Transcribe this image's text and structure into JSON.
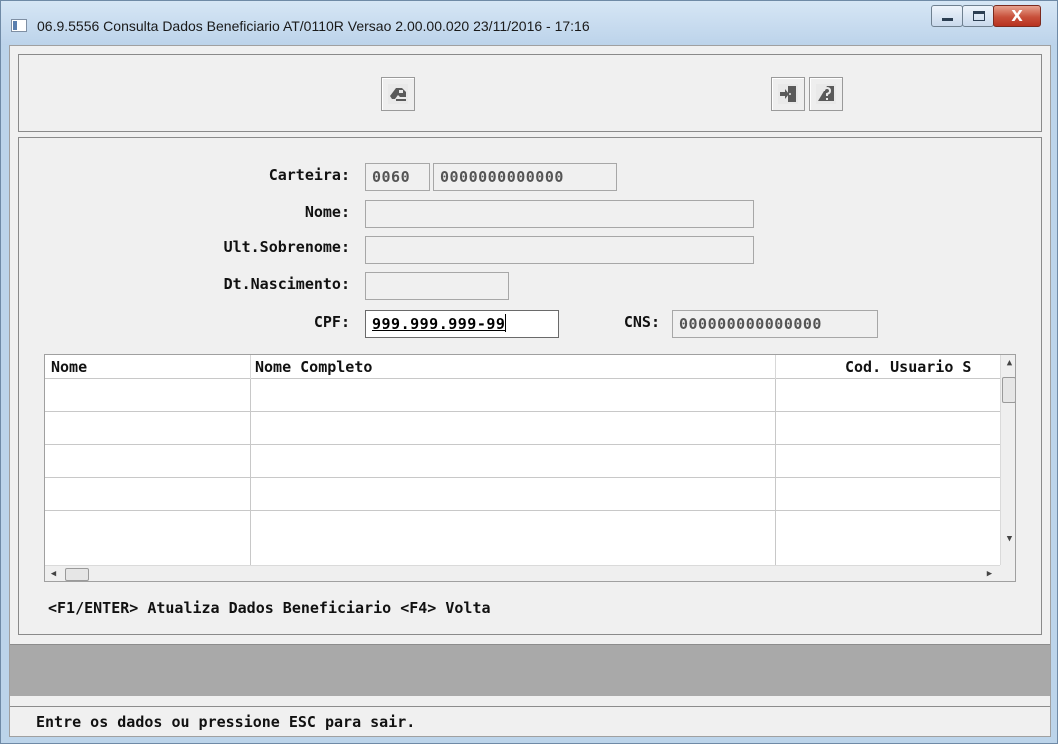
{
  "window": {
    "title": "06.9.5556  Consulta Dados Beneficiario AT/0110R Versao 2.00.00.020 23/11/2016 - 17:16",
    "close_glyph": "X"
  },
  "toolbar": {
    "left_icon": "key-icon",
    "exit_icon": "exit-door-icon",
    "help_icon": "help-icon"
  },
  "form": {
    "carteira_label": "Carteira:",
    "carteira_prefix": "0060",
    "carteira_number": "0000000000000",
    "nome_label": "Nome:",
    "nome_value": "",
    "ult_sobrenome_label": "Ult.Sobrenome:",
    "ult_sobrenome_value": "",
    "dt_nascimento_label": "Dt.Nascimento:",
    "dt_nascimento_value": "",
    "cpf_label": "CPF:",
    "cpf_value": "999.999.999-99",
    "cns_label": "CNS:",
    "cns_value": "000000000000000"
  },
  "grid": {
    "columns": [
      "Nome",
      "Nome Completo",
      "Cod. Usuario S"
    ],
    "rows": [
      [
        "",
        "",
        ""
      ],
      [
        "",
        "",
        ""
      ],
      [
        "",
        "",
        ""
      ],
      [
        "",
        "",
        ""
      ],
      [
        "",
        "",
        ""
      ]
    ]
  },
  "hint_text": "<F1/ENTER> Atualiza Dados Beneficiario  <F4> Volta",
  "status_text": "Entre os dados ou pressione ESC para sair."
}
